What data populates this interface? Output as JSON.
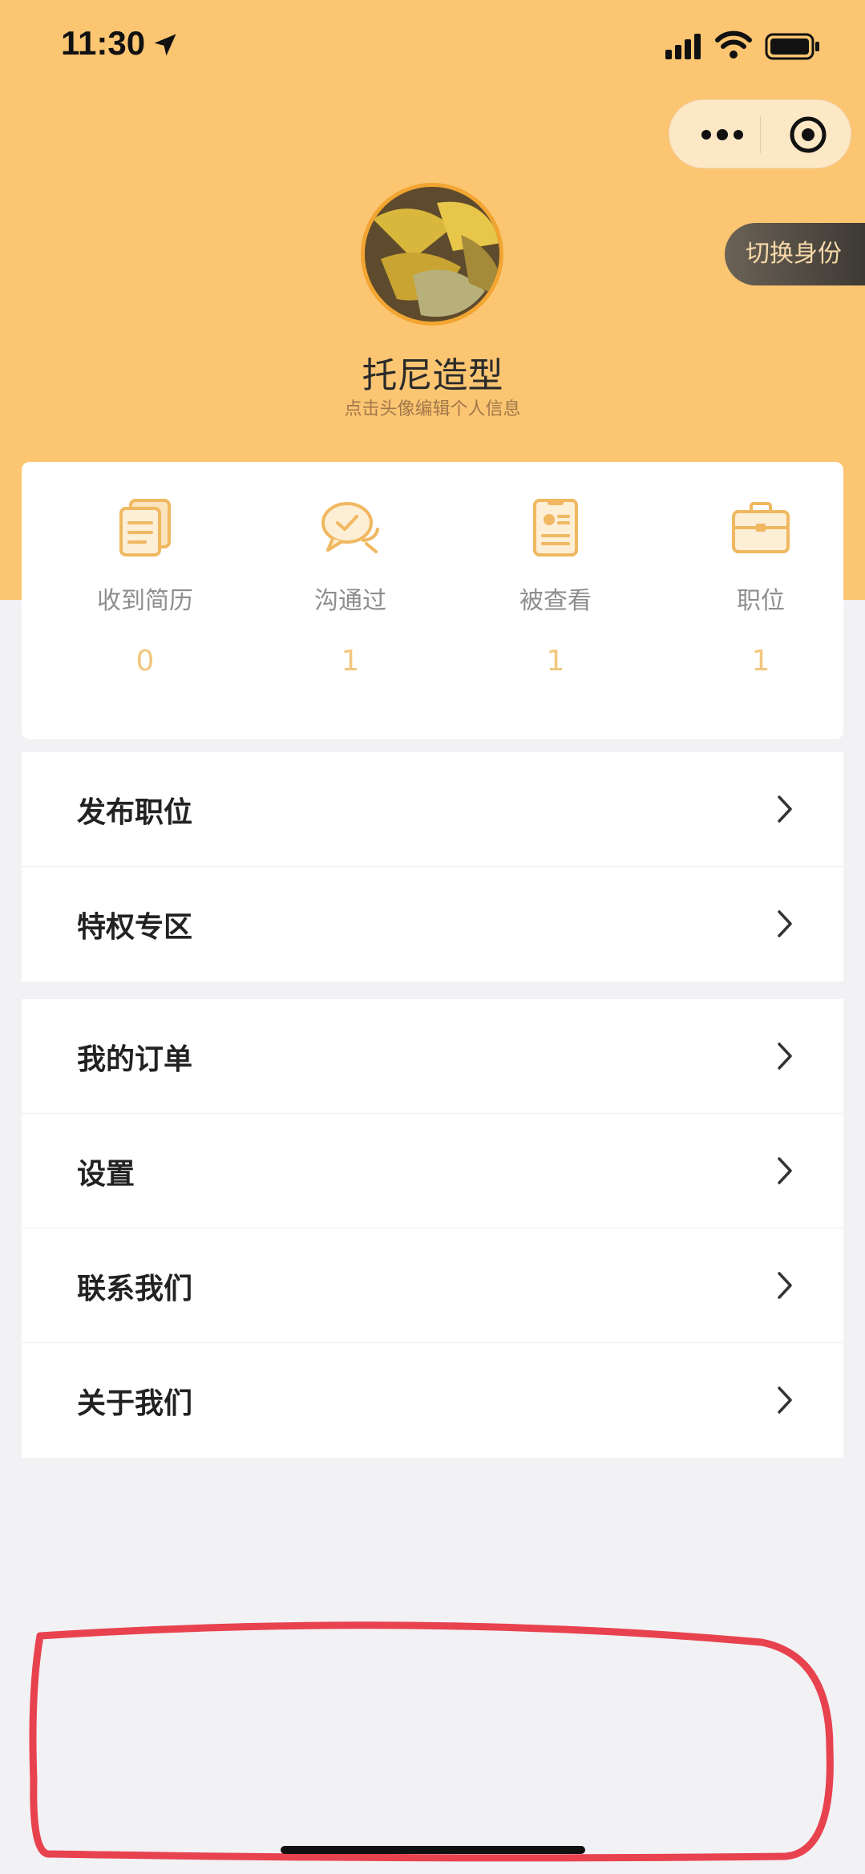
{
  "status_bar": {
    "time": "11:30",
    "icons": [
      "location-arrow-icon",
      "signal-icon",
      "wifi-icon",
      "battery-icon"
    ]
  },
  "capsule": {
    "more_icon": "more-dots-icon",
    "close_icon": "target-close-icon"
  },
  "header": {
    "switch_identity": "切换身份",
    "profile_name": "托尼造型",
    "profile_hint": "点击头像编辑个人信息",
    "background_color": "#fbc572"
  },
  "stats": [
    {
      "label": "收到简历",
      "value": "0",
      "icon": "resume-stack-icon"
    },
    {
      "label": "沟通过",
      "value": "1",
      "icon": "chat-check-icon"
    },
    {
      "label": "被查看",
      "value": "1",
      "icon": "id-card-icon"
    },
    {
      "label": "职位",
      "value": "1",
      "icon": "briefcase-icon"
    }
  ],
  "menu_group_1": [
    {
      "label": "发布职位"
    },
    {
      "label": "特权专区"
    }
  ],
  "menu_group_2": [
    {
      "label": "我的订单"
    },
    {
      "label": "设置"
    },
    {
      "label": "联系我们"
    },
    {
      "label": "关于我们"
    }
  ],
  "colors": {
    "accent": "#f2c77f",
    "icon_stroke": "#f0b860",
    "annotation": "#e8424f"
  }
}
